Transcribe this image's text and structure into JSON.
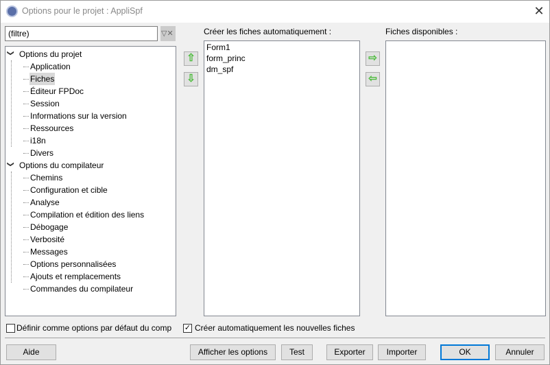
{
  "window": {
    "title": "Options pour le projet : AppliSpf",
    "close_icon": "close-icon"
  },
  "filter": {
    "value": "(filtre)",
    "clear_icon": "filter-clear-icon"
  },
  "tree": [
    {
      "label": "Options du projet",
      "level": 0,
      "expanded": true
    },
    {
      "label": "Application",
      "level": 1
    },
    {
      "label": "Fiches",
      "level": 1,
      "selected": true
    },
    {
      "label": "Éditeur FPDoc",
      "level": 1
    },
    {
      "label": "Session",
      "level": 1
    },
    {
      "label": "Informations sur la version",
      "level": 1
    },
    {
      "label": "Ressources",
      "level": 1
    },
    {
      "label": "i18n",
      "level": 1
    },
    {
      "label": "Divers",
      "level": 1
    },
    {
      "label": "Options du compilateur",
      "level": 0,
      "expanded": true
    },
    {
      "label": "Chemins",
      "level": 1
    },
    {
      "label": "Configuration et cible",
      "level": 1
    },
    {
      "label": "Analyse",
      "level": 1
    },
    {
      "label": "Compilation et édition des liens",
      "level": 1
    },
    {
      "label": "Débogage",
      "level": 1
    },
    {
      "label": "Verbosité",
      "level": 1
    },
    {
      "label": "Messages",
      "level": 1
    },
    {
      "label": "Options personnalisées",
      "level": 1
    },
    {
      "label": "Ajouts et remplacements",
      "level": 1
    },
    {
      "label": "Commandes du compilateur",
      "level": 1
    }
  ],
  "autocreate": {
    "label": "Créer les fiches automatiquement :",
    "items": [
      "Form1",
      "form_princ",
      "dm_spf"
    ]
  },
  "available": {
    "label": "Fiches disponibles :",
    "items": []
  },
  "arrows": {
    "up": "⇧",
    "down": "⇩",
    "right": "⇨",
    "left": "⇦"
  },
  "checkboxes": {
    "default_options": {
      "label": "Définir comme options par défaut du comp",
      "checked": false
    },
    "auto_create_new": {
      "label": "Créer automatiquement les nouvelles fiches",
      "checked": true
    }
  },
  "buttons": {
    "help": "Aide",
    "show_options": "Afficher les options",
    "test": "Test",
    "export": "Exporter",
    "import": "Importer",
    "ok": "OK",
    "cancel": "Annuler"
  },
  "colors": {
    "arrow": "#4cbb3c",
    "ok_border": "#0078d7",
    "selection": "#d9d9d9"
  }
}
